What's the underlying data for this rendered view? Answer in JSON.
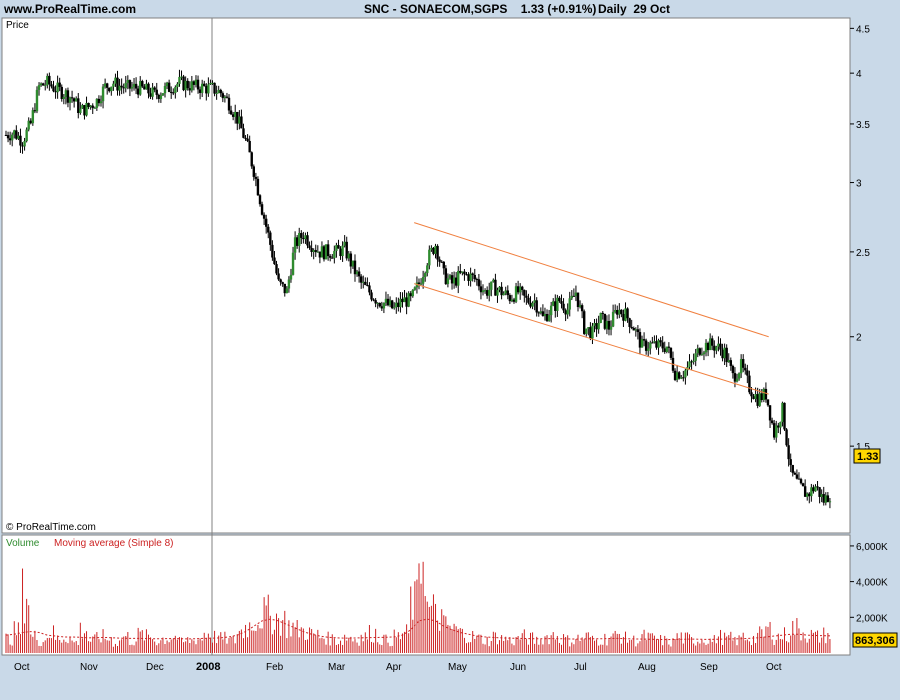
{
  "header": {
    "site": "www.ProRealTime.com",
    "title": "SNC - SONAECOM,SGPS",
    "price_change": "1.33 (+0.91%)",
    "period": "Daily",
    "date": "29 Oct"
  },
  "price_panel": {
    "label": "Price",
    "copyright": "© ProRealTime.com",
    "last_price_label": "1.33"
  },
  "volume_panel": {
    "label_volume": "Volume",
    "label_ma": "Moving average (Simple 8)",
    "last_volume_label": "863,306"
  },
  "colors": {
    "background": "#c9d9e8",
    "plot": "#ffffff",
    "up_candle": "#2e8b2e",
    "down_candle": "#000000",
    "channel": "#f08040",
    "volume_bar": "#cc2222",
    "volume_ma": "#cc2222",
    "volume_label": "#2e8b2e",
    "last_tag": "#ffd700"
  },
  "chart_data": [
    {
      "type": "candlestick",
      "y_scale": "log",
      "ylim": [
        1.2,
        4.6
      ],
      "yticks": [
        "1.5",
        "2",
        "2.5",
        "3",
        "3.5",
        "4",
        "4.5"
      ],
      "yticks_values": [
        1.5,
        2,
        2.5,
        3,
        3.5,
        4,
        4.5
      ],
      "xticks": [
        "Oct",
        "Nov",
        "Dec",
        "2008",
        "Feb",
        "Mar",
        "Apr",
        "May",
        "Jun",
        "Jul",
        "Aug",
        "Sep",
        "Oct"
      ],
      "xticks_bold": [
        false,
        false,
        false,
        true,
        false,
        false,
        false,
        false,
        false,
        false,
        false,
        false,
        false
      ],
      "year_divider_index": 3,
      "last_value": 1.33,
      "price_path": [
        3.4,
        3.42,
        3.35,
        3.5,
        3.86,
        3.9,
        3.84,
        3.8,
        3.75,
        3.62,
        3.66,
        3.72,
        3.86,
        3.9,
        3.86,
        3.85,
        3.85,
        3.82,
        3.78,
        3.82,
        3.86,
        3.9,
        3.88,
        3.86,
        3.85,
        3.84,
        3.8,
        3.7,
        3.55,
        3.35,
        3.1,
        2.8,
        2.55,
        2.3,
        2.25,
        2.55,
        2.62,
        2.55,
        2.5,
        2.5,
        2.5,
        2.52,
        2.4,
        2.3,
        2.25,
        2.2,
        2.18,
        2.15,
        2.2,
        2.2,
        2.3,
        2.45,
        2.55,
        2.35,
        2.3,
        2.35,
        2.35,
        2.32,
        2.25,
        2.28,
        2.25,
        2.22,
        2.25,
        2.2,
        2.2,
        2.1,
        2.15,
        2.2,
        2.15,
        2.25,
        2.05,
        2.02,
        2.1,
        2.05,
        2.15,
        2.12,
        2.05,
        1.95,
        1.96,
        1.95,
        1.95,
        1.82,
        1.82,
        1.86,
        1.94,
        1.96,
        1.95,
        1.92,
        1.8,
        1.85,
        1.75,
        1.7,
        1.72,
        1.55,
        1.65,
        1.4,
        1.35,
        1.32,
        1.35,
        1.3,
        1.33
      ],
      "channel": {
        "upper": [
          [
            0.486,
            2.7
          ],
          [
            0.906,
            2.0
          ]
        ],
        "lower": [
          [
            0.486,
            2.3
          ],
          [
            0.906,
            1.72
          ]
        ]
      }
    },
    {
      "type": "bar",
      "ylim": [
        0,
        6500000
      ],
      "yticks": [
        "2,000K",
        "4,000K",
        "6,000K"
      ],
      "yticks_values": [
        2000000,
        4000000,
        6000000
      ],
      "last_value": 863306,
      "volume_levels": [
        800000,
        1200000,
        3300000,
        900000,
        700000,
        1100000,
        800000,
        900000,
        600000,
        1300000,
        700000,
        900000,
        800000,
        600000,
        900000,
        700000,
        1000000,
        900000,
        700000,
        800000,
        900000,
        600000,
        700000,
        800000,
        1100000,
        900000,
        800000,
        700000,
        1200000,
        1500000,
        1900000,
        2200000,
        2000000,
        1800000,
        1500000,
        1300000,
        1200000,
        1000000,
        900000,
        800000,
        700000,
        900000,
        800000,
        900000,
        1100000,
        800000,
        700000,
        900000,
        1100000,
        2800000,
        5600000,
        2400000,
        2000000,
        1500000,
        1300000,
        1100000,
        900000,
        800000,
        700000,
        900000,
        800000,
        700000,
        900000,
        800000,
        700000,
        900000,
        1000000,
        800000,
        700000,
        800000,
        900000,
        700000,
        800000,
        900000,
        1000000,
        800000,
        700000,
        900000,
        800000,
        700000,
        600000,
        900000,
        800000,
        700000,
        800000,
        700000,
        900000,
        800000,
        700000,
        900000,
        800000,
        1000000,
        1300000,
        900000,
        1000000,
        1400000,
        1200000,
        1000000,
        900000,
        1000000,
        1000000
      ],
      "ma_levels": [
        1000000,
        1050000,
        1150000,
        1200000,
        1150000,
        1000000,
        950000,
        900000,
        900000,
        880000,
        850000,
        860000,
        870000,
        850000,
        830000,
        820000,
        820000,
        810000,
        800000,
        800000,
        810000,
        800000,
        790000,
        800000,
        820000,
        830000,
        850000,
        900000,
        1000000,
        1200000,
        1500000,
        1800000,
        1900000,
        1800000,
        1600000,
        1400000,
        1200000,
        1050000,
        950000,
        880000,
        850000,
        830000,
        840000,
        850000,
        860000,
        870000,
        880000,
        900000,
        1000000,
        1300000,
        1800000,
        1900000,
        1800000,
        1500000,
        1300000,
        1150000,
        1050000,
        950000,
        900000,
        870000,
        850000,
        830000,
        820000,
        810000,
        800000,
        800000,
        810000,
        800000,
        790000,
        780000,
        790000,
        800000,
        800000,
        810000,
        820000,
        800000,
        790000,
        780000,
        770000,
        760000,
        750000,
        760000,
        770000,
        780000,
        770000,
        760000,
        770000,
        780000,
        790000,
        800000,
        820000,
        850000,
        900000,
        950000,
        1000000,
        1050000,
        1050000,
        1000000,
        980000,
        970000,
        960000
      ]
    }
  ]
}
